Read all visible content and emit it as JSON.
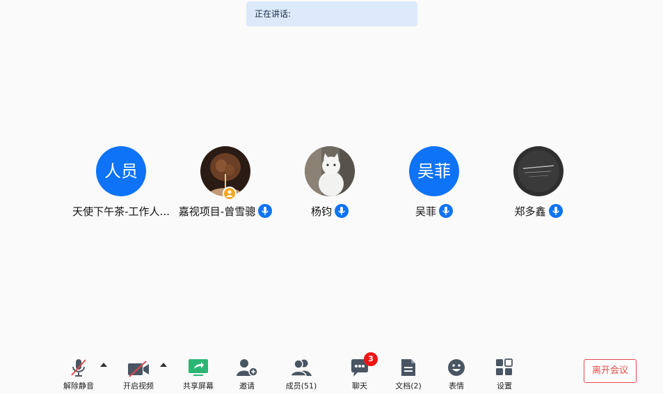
{
  "speaking": {
    "label": "正在讲话:"
  },
  "participants": [
    {
      "name": "天使下午茶-工作人...",
      "avatar_text": "人员",
      "avatar_type": "initials",
      "mic": false,
      "host": false
    },
    {
      "name": "嘉视项目-曾雪骢",
      "avatar_type": "photo",
      "mic": true,
      "host": true
    },
    {
      "name": "杨钧",
      "avatar_type": "photo",
      "mic": true,
      "host": false
    },
    {
      "name": "吴菲",
      "avatar_text": "吴菲",
      "avatar_type": "initials",
      "mic": true,
      "host": false
    },
    {
      "name": "郑多鑫",
      "avatar_type": "photo",
      "mic": true,
      "host": false
    }
  ],
  "toolbar": {
    "unmute": "解除静音",
    "start_video": "开启视频",
    "share_screen": "共享屏幕",
    "invite": "邀请",
    "members": "成员(51)",
    "chat": "聊天",
    "chat_badge": "3",
    "docs": "文档(2)",
    "emoji": "表情",
    "settings": "设置"
  },
  "leave": {
    "label": "离开会议"
  },
  "colors": {
    "accent": "#0e73f6",
    "share": "#2bb673",
    "danger": "#e04a4a",
    "badge": "#f01414"
  }
}
